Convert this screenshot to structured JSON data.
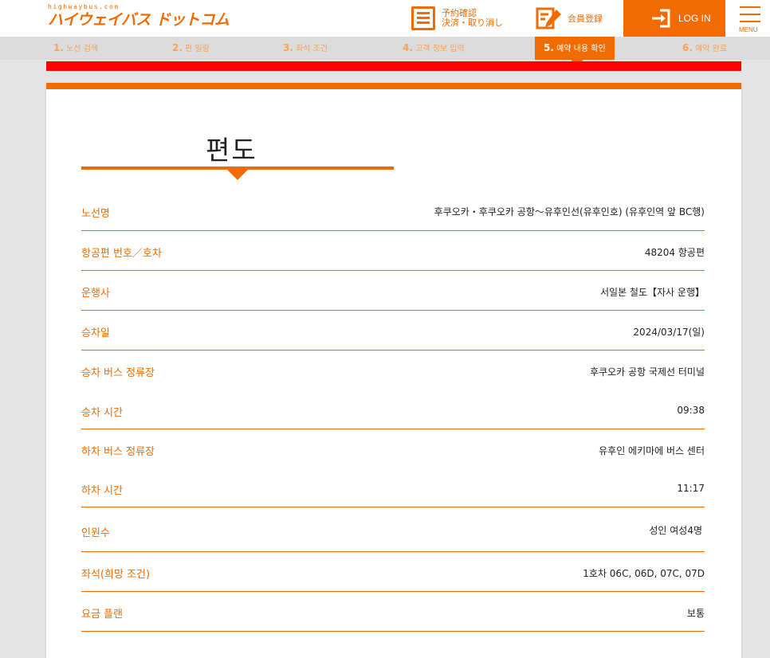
{
  "header": {
    "logo_small": "highwaybus.com",
    "logo_main": "ハイウェイバス ドットコム",
    "confirm_line1": "予約確認",
    "confirm_line2": "決済・取り消し",
    "register_label": "会員登録",
    "login_label": "LOG IN",
    "menu_label": "MENU"
  },
  "steps": [
    {
      "num": "1.",
      "label": "노선 검색"
    },
    {
      "num": "2.",
      "label": "편 일람"
    },
    {
      "num": "3.",
      "label": "좌석 조건"
    },
    {
      "num": "4.",
      "label": "고객 정보 입력"
    },
    {
      "num": "5.",
      "label": "예약 내용 확인"
    },
    {
      "num": "6.",
      "label": "예약 완료"
    }
  ],
  "card": {
    "title": "편도",
    "rows": [
      {
        "label": "노선명",
        "value": "후쿠오카・후쿠오카 공항～유후인선(유후인호) (유후인역 앞 BC행)"
      },
      {
        "label": "항공편 번호／호차",
        "value": "48204 항공편"
      },
      {
        "label": "운행사",
        "value": "서일본 철도【자사 운행】"
      },
      {
        "label": "승차일",
        "value": "2024/03/17(일)"
      },
      {
        "label": "승차 버스 정류장",
        "value": "후쿠오카 공항 국제선 터미널"
      },
      {
        "label": "승차 시간",
        "value": "09:38"
      },
      {
        "label": "하차 버스 정류장",
        "value": "유후인 에키마에 버스 센터"
      },
      {
        "label": "하차 시간",
        "value": "11:17"
      },
      {
        "label": "인원수",
        "value": "성인 여성4명"
      },
      {
        "label": "좌석(희망 조건)",
        "value": "1호차 06C, 06D, 07C, 07D"
      },
      {
        "label": "요금 플랜",
        "value": "보통"
      }
    ]
  },
  "colors": {
    "accent": "#f26b00",
    "alert_bar": "#ff0000",
    "background": "#e5e5e5"
  }
}
